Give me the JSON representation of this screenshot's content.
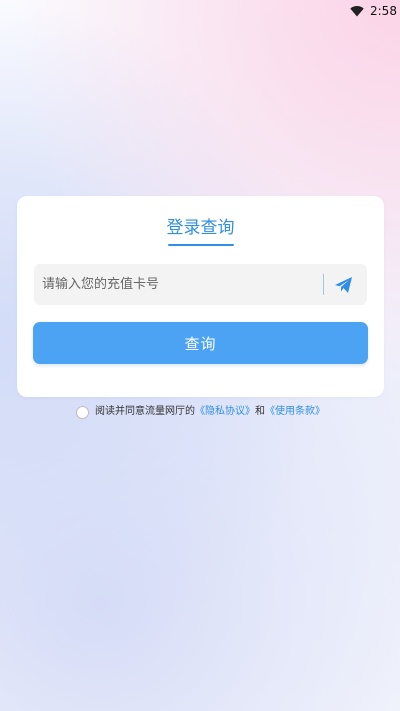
{
  "status_bar": {
    "time": "2:58",
    "icons": [
      "wifi-icon"
    ]
  },
  "login_card": {
    "title": "登录查询",
    "input_placeholder": "请输入您的充值卡号",
    "input_value": "",
    "send_icon": "paper-plane-icon",
    "query_button_label": "查询"
  },
  "agreement": {
    "checked": false,
    "prefix": "阅读并同意流量网厅的",
    "privacy_link": "《隐私协议》",
    "conjunction": "和",
    "terms_link": "《使用条款》"
  },
  "colors": {
    "accent": "#2f8ee6",
    "button": "#4ca3f4",
    "input_bg": "#f3f3f3"
  }
}
